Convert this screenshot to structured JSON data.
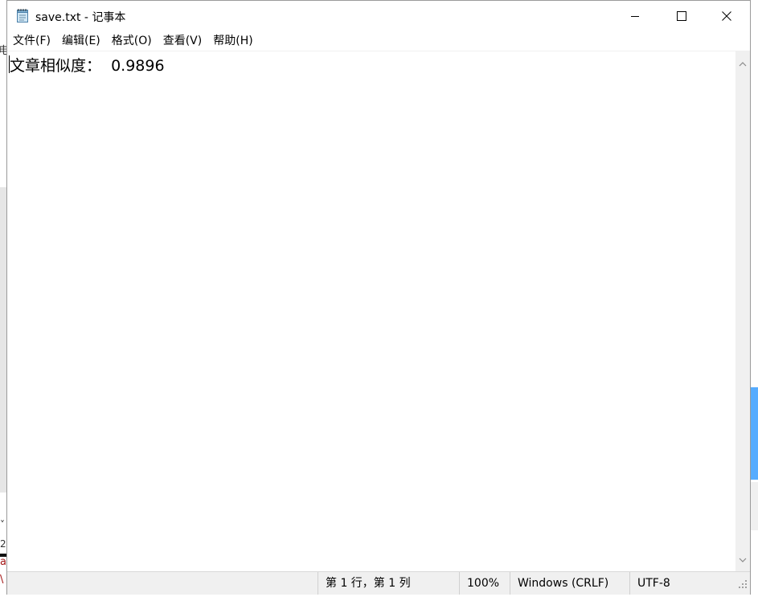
{
  "window": {
    "title": "save.txt - 记事本",
    "icon": "notepad-icon",
    "controls": {
      "minimize_icon": "minimize-icon",
      "maximize_icon": "maximize-icon",
      "close_icon": "close-icon"
    }
  },
  "menu": {
    "items": [
      {
        "label": "文件(F)",
        "name": "file"
      },
      {
        "label": "编辑(E)",
        "name": "edit"
      },
      {
        "label": "格式(O)",
        "name": "format"
      },
      {
        "label": "查看(V)",
        "name": "view"
      },
      {
        "label": "帮助(H)",
        "name": "help"
      }
    ]
  },
  "editor": {
    "content": "文章相似度：  0.9896"
  },
  "statusbar": {
    "position": "第 1 行，第 1 列",
    "zoom": "100%",
    "line_ending": "Windows (CRLF)",
    "encoding": "UTF-8"
  },
  "background": {
    "left_chars": [
      "电",
      "˅",
      "2",
      "a",
      "\\"
    ]
  },
  "colors": {
    "statusbar_bg": "#f0f0f0",
    "scrollbar_bg": "#f0f0f0",
    "text": "#000000"
  }
}
